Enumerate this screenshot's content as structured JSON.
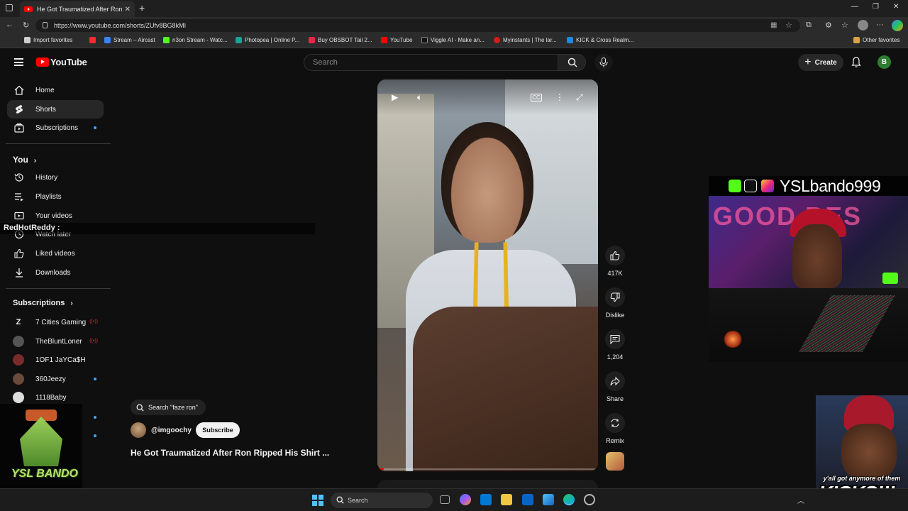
{
  "browser": {
    "tab_title": "He Got Traumatized After Ron Ri",
    "url": "https://www.youtube.com/shorts/ZUfv8BG8kMI",
    "bookmarks": [
      {
        "label": "Import favorites",
        "color": "#cfcfcf"
      },
      {
        "label": "",
        "color": "#ff2a2a"
      },
      {
        "label": "Stream – Aircast",
        "color": "#3b82f6"
      },
      {
        "label": "n3on Stream - Watc...",
        "color": "#53fc18"
      },
      {
        "label": "Photopea | Online P...",
        "color": "#18a497"
      },
      {
        "label": "Buy OBSBOT Tail 2...",
        "color": "#e02a4a"
      },
      {
        "label": "YouTube",
        "color": "#ff0000"
      },
      {
        "label": "Viggle AI - Make an...",
        "color": "#111111"
      },
      {
        "label": "Myinstants | The lar...",
        "color": "#d81b1b"
      },
      {
        "label": "KICK & Cross Realm...",
        "color": "#1e88e5"
      },
      {
        "label": "Other favorites",
        "color": "#d9a441"
      }
    ]
  },
  "header": {
    "logo_text": "YouTube",
    "search_placeholder": "Search",
    "create_label": "Create",
    "avatar_letter": "B"
  },
  "sidebar": {
    "main": [
      {
        "label": "Home",
        "icon": "home-icon"
      },
      {
        "label": "Shorts",
        "icon": "shorts-icon",
        "active": true
      },
      {
        "label": "Subscriptions",
        "icon": "subscriptions-icon"
      }
    ],
    "you_heading": "You",
    "you": [
      {
        "label": "History",
        "icon": "history-icon"
      },
      {
        "label": "Playlists",
        "icon": "playlists-icon"
      },
      {
        "label": "Your videos",
        "icon": "your-videos-icon"
      },
      {
        "label": "Watch later",
        "icon": "watch-later-icon"
      },
      {
        "label": "Liked videos",
        "icon": "liked-videos-icon"
      },
      {
        "label": "Downloads",
        "icon": "downloads-icon"
      }
    ],
    "subs_heading": "Subscriptions",
    "subs": [
      {
        "label": "7 Cities Gaming",
        "live": true
      },
      {
        "label": "TheBluntLoner",
        "live": true
      },
      {
        "label": "1OF1 JaYCa$H",
        "live": false
      },
      {
        "label": "360Jeezy",
        "live": false
      },
      {
        "label": "1118Baby",
        "live": false
      }
    ]
  },
  "chat_overlay": {
    "username": "RedHotReddy :"
  },
  "short": {
    "search_pill": "Search \"faze ron\"",
    "channel": "@imgoochy",
    "subscribe_label": "Subscribe",
    "title": "He Got Traumatized After Ron Ripped His Shirt ...",
    "progress_fraction": 0.03,
    "actions": {
      "likes": "417K",
      "dislike": "Dislike",
      "comments": "1,204",
      "share": "Share",
      "remix": "Remix"
    }
  },
  "stream_overlay": {
    "handle": "YSLbando999",
    "webcam_sign": "GOOD BES",
    "logo_text": "YSL BANDO",
    "meme_caption_top": "y'all got anymore of them",
    "meme_caption_bottom": "KICKS!!!"
  },
  "taskbar": {
    "search_label": "Search"
  }
}
